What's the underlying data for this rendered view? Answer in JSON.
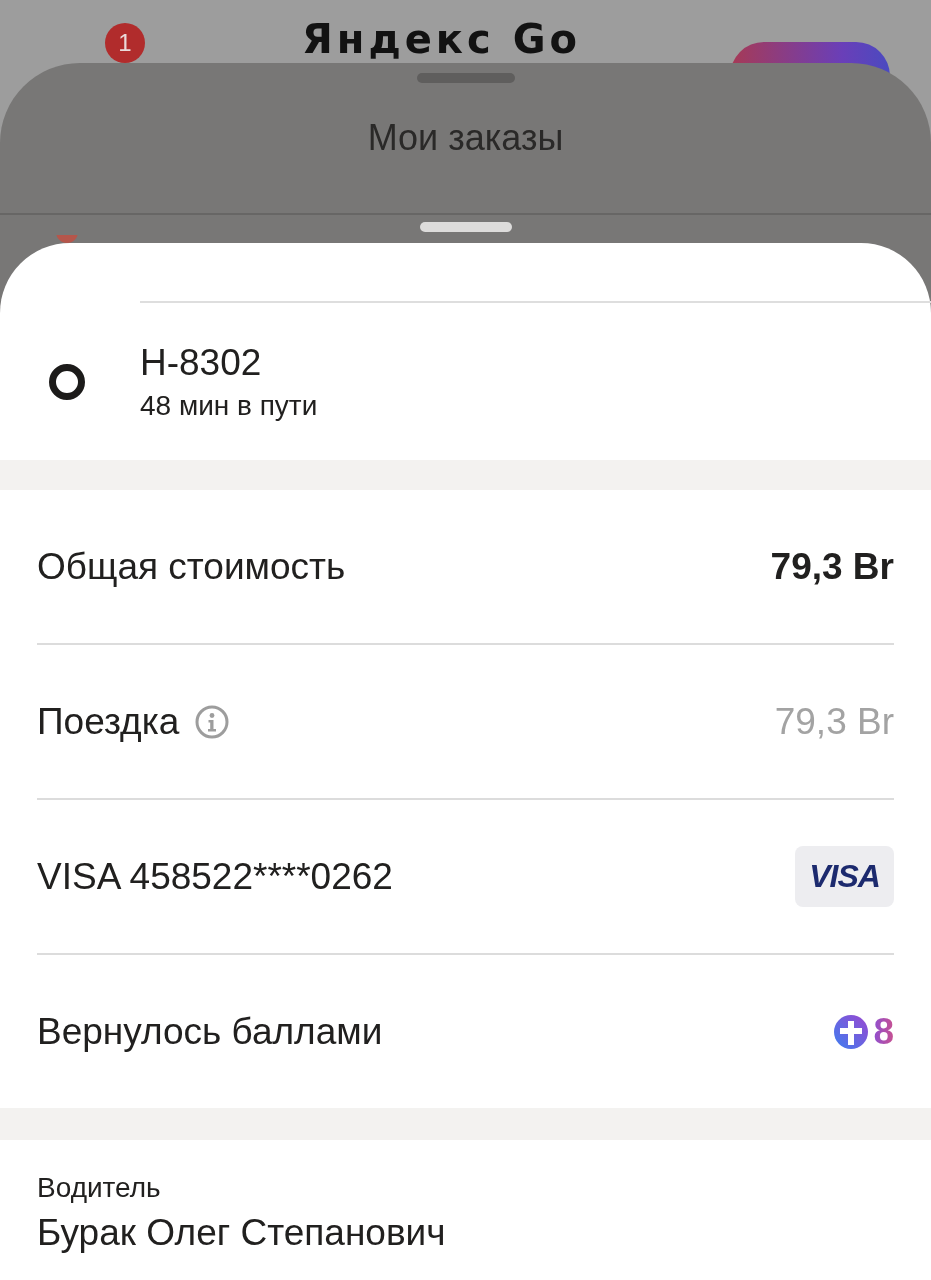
{
  "background": {
    "notification_badge": "1",
    "logo": "Яндекс Go"
  },
  "sheet": {
    "title": "Мои заказы"
  },
  "route_point": {
    "title": "Н-8302",
    "subtitle": "48 мин в пути"
  },
  "payment_rows": [
    {
      "kind": "total",
      "label": "Общая стоимость",
      "value": "79,3 Br"
    },
    {
      "kind": "trip",
      "label": "Поездка",
      "value": "79,3 Br"
    },
    {
      "kind": "card",
      "label": "VISA 458522****0262",
      "badge": "VISA"
    },
    {
      "kind": "points",
      "label": "Вернулось баллами",
      "value": "8"
    }
  ],
  "driver": {
    "label": "Водитель",
    "name": "Бурак Олег Степанович"
  }
}
